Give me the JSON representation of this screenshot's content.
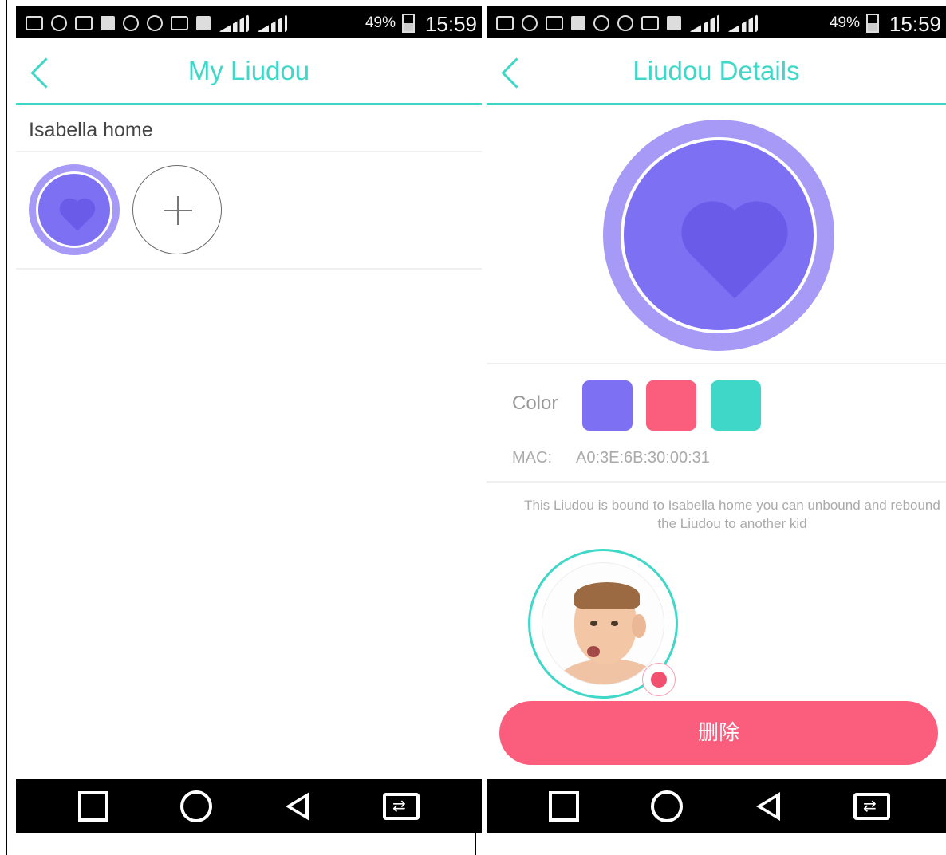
{
  "status_bar": {
    "battery": "49%",
    "time": "15:59",
    "icons": [
      "back-arrow-icon",
      "cloud-icon",
      "badge-49-icon",
      "facebook-icon",
      "search-icon",
      "bluetooth-icon",
      "vibrate-icon",
      "network-3g-icon",
      "signal-3g-icon",
      "signal-2g-icon",
      "battery-icon"
    ]
  },
  "screens": {
    "my_liudou": {
      "title": "My Liudou",
      "home_name": "Isabella home",
      "devices": [
        {
          "color": "#7e70f3",
          "icon": "heart-icon"
        }
      ],
      "add_icon": "plus-icon"
    },
    "liudou_details": {
      "title": "Liudou Details",
      "bead_color": "#7e70f3",
      "color_label": "Color",
      "colors": [
        "#7e70f3",
        "#fb5d7d",
        "#3fd8c8"
      ],
      "mac_label": "MAC:",
      "mac_value": "A0:3E:6B:30:00:31",
      "bind_note": "This Liudou is bound to Isabella home you can unbound and rebound the Liudou to another kid",
      "delete_label": "删除"
    }
  },
  "nav_bar": {
    "icons": [
      "recent-apps-icon",
      "home-icon",
      "back-icon",
      "switch-sim-icon"
    ]
  },
  "colors": {
    "accent": "#3fd8c8",
    "bead_outer": "#a79af6",
    "bead_inner": "#7e70f3",
    "delete": "#fb5d7d"
  }
}
